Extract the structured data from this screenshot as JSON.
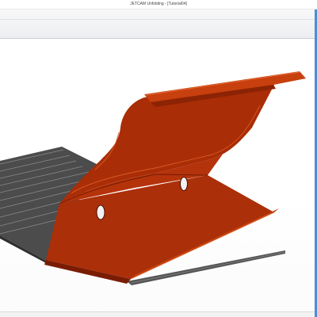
{
  "window": {
    "title": "JETCAM Unfolding - [Tutorial04]"
  },
  "viewport": {
    "content": "3D part view",
    "colors": {
      "folded_part": "#b5330b",
      "folded_part_shadow": "#7a1c03",
      "flat_blank": "#4c4c4c",
      "flat_blank_lines": "#8a8a8a",
      "hole": "#f2f2f2",
      "frame_accent": "#4a8fd6"
    }
  }
}
